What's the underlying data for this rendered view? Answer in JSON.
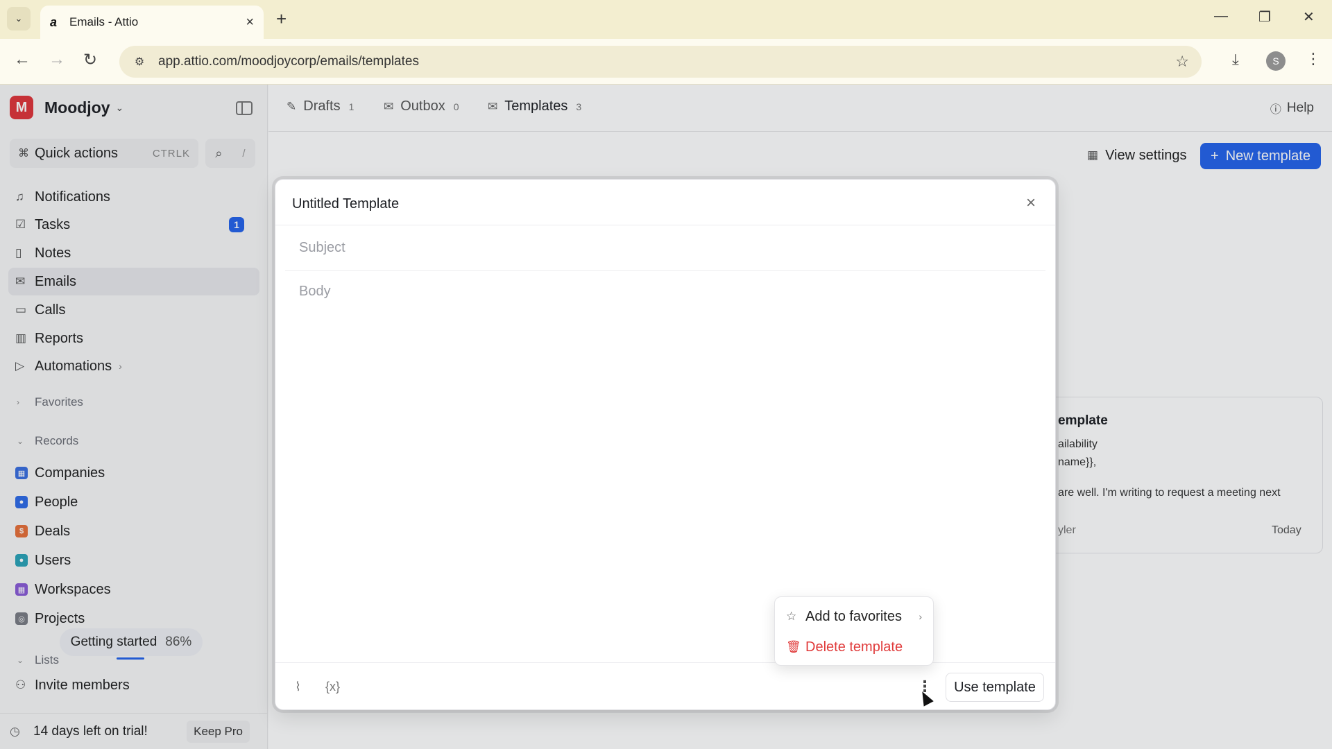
{
  "browser": {
    "tab_title": "Emails - Attio",
    "url": "app.attio.com/moodjoycorp/emails/templates",
    "profile_initial": "S"
  },
  "sidebar": {
    "workspace_initial": "M",
    "workspace_name": "Moodjoy",
    "quick_actions": {
      "label": "Quick actions",
      "shortcut": "CTRLK"
    },
    "search_shortcut": "/",
    "nav": [
      {
        "label": "Notifications",
        "icon": "bell-icon"
      },
      {
        "label": "Tasks",
        "icon": "check-square-icon",
        "badge": "1"
      },
      {
        "label": "Notes",
        "icon": "note-icon"
      },
      {
        "label": "Emails",
        "icon": "mail-icon",
        "active": true
      },
      {
        "label": "Calls",
        "icon": "video-icon"
      },
      {
        "label": "Reports",
        "icon": "chart-icon"
      },
      {
        "label": "Automations",
        "icon": "play-icon"
      }
    ],
    "favorites_label": "Favorites",
    "records_label": "Records",
    "records": [
      {
        "label": "Companies",
        "color": "#3b6fe0"
      },
      {
        "label": "People",
        "color": "#2f6be8"
      },
      {
        "label": "Deals",
        "color": "#e8703a"
      },
      {
        "label": "Users",
        "color": "#2ba3b8"
      },
      {
        "label": "Workspaces",
        "color": "#8a5cd6"
      },
      {
        "label": "Projects",
        "color": "#7a7d85"
      }
    ],
    "getting_started": {
      "label": "Getting started",
      "percent": "86%"
    },
    "lists_label": "Lists",
    "invite_label": "Invite members",
    "trial_text": "14 days left on trial!",
    "keep_pro_label": "Keep Pro"
  },
  "main": {
    "tabs": [
      {
        "label": "Drafts",
        "count": "1"
      },
      {
        "label": "Outbox",
        "count": "0"
      },
      {
        "label": "Templates",
        "count": "3"
      }
    ],
    "help_label": "Help",
    "view_settings_label": "View settings",
    "new_template_label": "New template",
    "background_card": {
      "title_fragment": "emplate",
      "line1": "ailability",
      "line2": "name}},",
      "line3": "are well. I'm writing to request a meeting next",
      "author_fragment": "yler",
      "date": "Today"
    }
  },
  "modal": {
    "title": "Untitled Template",
    "subject_placeholder": "Subject",
    "body_placeholder": "Body",
    "use_template_label": "Use template"
  },
  "dropdown": {
    "add_favorites_label": "Add to favorites",
    "delete_label": "Delete template"
  },
  "colors": {
    "accent": "#2563eb",
    "danger": "#e03a3a",
    "workspace": "#e0353b"
  }
}
